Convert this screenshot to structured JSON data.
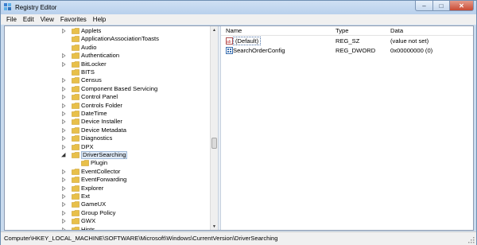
{
  "window": {
    "title": "Registry Editor",
    "caption_min": "–",
    "caption_max": "□",
    "caption_close": "✕"
  },
  "menu": [
    "File",
    "Edit",
    "View",
    "Favorites",
    "Help"
  ],
  "tree": {
    "items": [
      {
        "label": "Applets",
        "expander": true
      },
      {
        "label": "ApplicationAssociationToasts",
        "expander": false
      },
      {
        "label": "Audio",
        "expander": false
      },
      {
        "label": "Authentication",
        "expander": true
      },
      {
        "label": "BitLocker",
        "expander": true
      },
      {
        "label": "BITS",
        "expander": false
      },
      {
        "label": "Census",
        "expander": true
      },
      {
        "label": "Component Based Servicing",
        "expander": true
      },
      {
        "label": "Control Panel",
        "expander": true
      },
      {
        "label": "Controls Folder",
        "expander": true
      },
      {
        "label": "DateTime",
        "expander": true
      },
      {
        "label": "Device Installer",
        "expander": true
      },
      {
        "label": "Device Metadata",
        "expander": true
      },
      {
        "label": "Diagnostics",
        "expander": true
      },
      {
        "label": "DPX",
        "expander": true
      },
      {
        "label": "DriverSearching",
        "expander": true,
        "expanded": true,
        "selected": true
      },
      {
        "label": "Plugin",
        "expander": false,
        "child": true
      },
      {
        "label": "EventCollector",
        "expander": true
      },
      {
        "label": "EventForwarding",
        "expander": true
      },
      {
        "label": "Explorer",
        "expander": true
      },
      {
        "label": "Ext",
        "expander": true
      },
      {
        "label": "GameUX",
        "expander": true
      },
      {
        "label": "Group Policy",
        "expander": true
      },
      {
        "label": "GWX",
        "expander": true
      },
      {
        "label": "Hints",
        "expander": true
      }
    ]
  },
  "list": {
    "columns": [
      "Name",
      "Type",
      "Data"
    ],
    "rows": [
      {
        "icon": "string-value-icon",
        "name": "(Default)",
        "type": "REG_SZ",
        "data": "(value not set)"
      },
      {
        "icon": "binary-value-icon",
        "name": "SearchOrderConfig",
        "type": "REG_DWORD",
        "data": "0x00000000 (0)"
      }
    ]
  },
  "status": {
    "path": "Computer\\HKEY_LOCAL_MACHINE\\SOFTWARE\\Microsoft\\Windows\\CurrentVersion\\DriverSearching"
  },
  "colors": {
    "folder": "#e8c04a",
    "folder_dark": "#c99a20",
    "accent": "#6f8fb3",
    "close": "#c94a33"
  }
}
